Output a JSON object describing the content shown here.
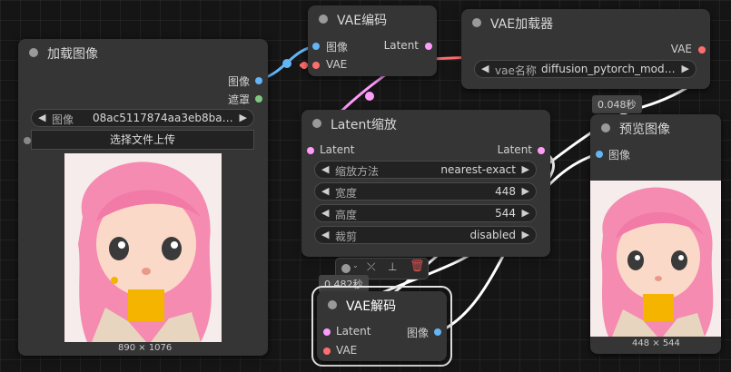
{
  "colors": {
    "canvas": "#151515",
    "node_bg": "#353535",
    "image_slot": "#64b5f6",
    "latent_slot": "#ff9cf9",
    "vae_slot": "#ff6e6e",
    "mask_slot": "#81c784",
    "link_latent": "#ff9cf9",
    "link_image": "#64b5f6",
    "link_vae": "#ff6e6e",
    "link_selected": "#ffffff"
  },
  "load_image": {
    "title": "加载图像",
    "out_image": "图像",
    "out_mask": "遮罩",
    "widget_label": "图像",
    "widget_value": "08ac5117874aa3eb8baf65…",
    "upload_button": "选择文件上传",
    "image_size": "890 × 1076"
  },
  "vae_encode": {
    "title": "VAE编码",
    "in_image": "图像",
    "in_vae": "VAE",
    "out_latent": "Latent"
  },
  "vae_loader": {
    "title": "VAE加载器",
    "out_vae": "VAE",
    "widget_label": "vae名称",
    "widget_value": "diffusion_pytorch_mod…"
  },
  "latent_scale": {
    "title": "Latent缩放",
    "in_latent": "Latent",
    "out_latent": "Latent",
    "widgets": [
      {
        "label": "缩放方法",
        "value": "nearest-exact"
      },
      {
        "label": "宽度",
        "value": "448"
      },
      {
        "label": "高度",
        "value": "544"
      },
      {
        "label": "裁剪",
        "value": "disabled"
      }
    ]
  },
  "preview": {
    "title": "预览图像",
    "in_image": "图像",
    "time": "0.048秒",
    "image_size": "448 × 544"
  },
  "vae_decode": {
    "title": "VAE解码",
    "in_latent": "Latent",
    "in_vae": "VAE",
    "out_image": "图像",
    "time": "0.482秒"
  },
  "toolbar": {
    "icons": [
      "color-picker-icon",
      "bypass-icon",
      "pin-icon",
      "delete-icon"
    ]
  }
}
